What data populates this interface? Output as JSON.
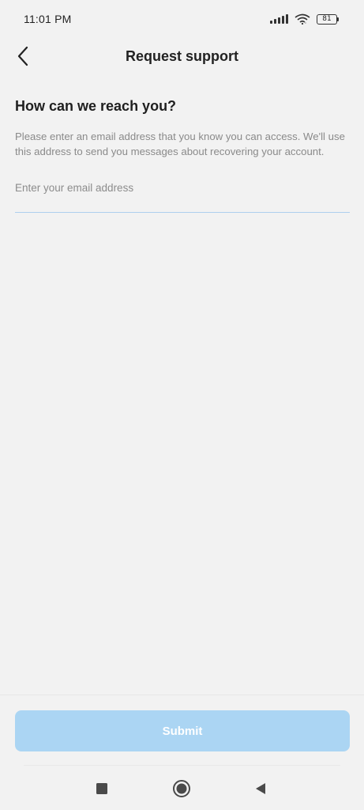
{
  "status_bar": {
    "time": "11:01 PM",
    "battery_level": "81",
    "icons": [
      "signal-icon",
      "wifi-icon",
      "battery-icon"
    ]
  },
  "header": {
    "title": "Request support",
    "back_icon": "chevron-left-icon"
  },
  "main": {
    "heading": "How can we reach you?",
    "description": "Please enter an email address that you know you can access. We'll use this address to send you messages about recovering your account.",
    "email_field": {
      "value": "",
      "placeholder": "Enter your email address"
    }
  },
  "footer": {
    "submit_label": "Submit",
    "submit_color": "#abd5f3"
  },
  "nav_bar": {
    "icons": [
      "recents-square-icon",
      "home-circle-icon",
      "back-triangle-icon"
    ]
  },
  "colors": {
    "background": "#f2f2f2",
    "accent_underline": "#aecfee"
  }
}
